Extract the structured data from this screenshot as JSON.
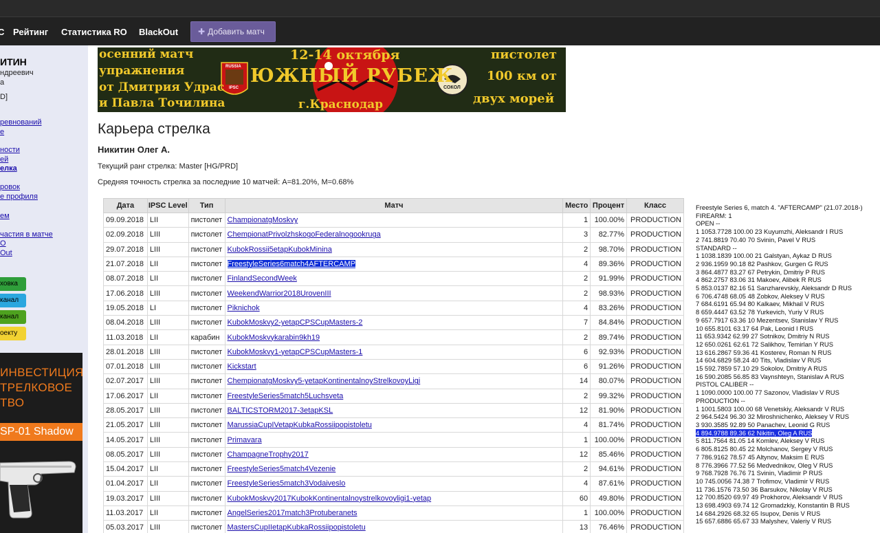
{
  "nav": {
    "cut_item": "C",
    "items": [
      "Рейтинг",
      "Статистика RO",
      "BlackOut"
    ],
    "add_match": "Добавить матч"
  },
  "sidebar": {
    "name": "ИТИН",
    "patronymic": "ндреевич",
    "line3": "а",
    "line4": "D]",
    "links": [
      "ревнований",
      "е",
      "ности",
      "ей",
      "елка",
      "ровок",
      "е профиля",
      "ем",
      "частия в матче",
      "O",
      "Out"
    ],
    "buttons": [
      {
        "label": "ховка",
        "color": "#2f9e3a"
      },
      {
        "label": "канал",
        "color": "#2aa7df"
      },
      {
        "label": "канал",
        "color": "#4ea21f"
      },
      {
        "label": "оекту",
        "color": "#f2d232"
      }
    ],
    "ad": {
      "line1": "ИНВЕСТИЦИЯ",
      "line2": "ТРЕЛКОВОЕ",
      "line3": "ТВО",
      "bar": "SP-01 Shadow"
    }
  },
  "banner": {
    "left1": "осенний матч",
    "left2": "упражнения",
    "left3": "от Дмитрия Удрас",
    "left4": "и Павла Точилина",
    "dates": "12-14 октября",
    "title": "ЮЖНЫЙ РУБЕЖ",
    "city": "г.Краснодар",
    "right1": "пистолет",
    "right2": "100 км от",
    "right3": "двух морей",
    "badge_left": "RUSSIA",
    "badge_left2": "IPSC",
    "badge_right": "СОКОЛ"
  },
  "page": {
    "title": "Карьера стрелка",
    "shooter": "Никитин Олег А.",
    "rank": "Текущий ранг стрелка: Master [HG/PRD]",
    "accuracy": "Средняя точность стрелка за последние 10 матчей: A=81.20%, M=0.68%"
  },
  "table": {
    "headers": [
      "Дата",
      "IPSC Level",
      "Тип",
      "Матч",
      "Место",
      "Процент",
      "Класс"
    ],
    "rows": [
      [
        "09.09.2018",
        "LII",
        "пистолет",
        "ChampionatgMoskvy",
        "1",
        "100.00%",
        "PRODUCTION"
      ],
      [
        "02.09.2018",
        "LIII",
        "пистолет",
        "ChempionatPrivolzhskogoFederalnogookruga",
        "3",
        "82.77%",
        "PRODUCTION"
      ],
      [
        "29.07.2018",
        "LIII",
        "пистолет",
        "KubokRossii5etapKubokMinina",
        "2",
        "98.70%",
        "PRODUCTION"
      ],
      [
        "21.07.2018",
        "LII",
        "пистолет",
        "FreestyleSeries6match4AFTERCAMP",
        "4",
        "89.36%",
        "PRODUCTION"
      ],
      [
        "08.07.2018",
        "LII",
        "пистолет",
        "FinlandSecondWeek",
        "2",
        "91.99%",
        "PRODUCTION"
      ],
      [
        "17.06.2018",
        "LIII",
        "пистолет",
        "WeekendWarrior2018UrovenIII",
        "2",
        "98.93%",
        "PRODUCTION"
      ],
      [
        "19.05.2018",
        "LI",
        "пистолет",
        "Piknichok",
        "4",
        "83.26%",
        "PRODUCTION"
      ],
      [
        "08.04.2018",
        "LIII",
        "пистолет",
        "KubokMoskvy2-yetapCPSCupMasters-2",
        "7",
        "84.84%",
        "PRODUCTION"
      ],
      [
        "11.03.2018",
        "LII",
        "карабин",
        "KubokMoskvykarabin9kh19",
        "2",
        "89.74%",
        "PRODUCTION"
      ],
      [
        "28.01.2018",
        "LIII",
        "пистолет",
        "KubokMoskvy1-yetapCPSCupMasters-1",
        "6",
        "92.93%",
        "PRODUCTION"
      ],
      [
        "07.01.2018",
        "LIII",
        "пистолет",
        "Kickstart",
        "6",
        "91.26%",
        "PRODUCTION"
      ],
      [
        "02.07.2017",
        "LIII",
        "пистолет",
        "ChempionatgMoskvy5-yetapKontinentalnoyStrelkovoyLigi",
        "14",
        "80.07%",
        "PRODUCTION"
      ],
      [
        "17.06.2017",
        "LII",
        "пистолет",
        "FreestyleSeries5match5Luchsveta",
        "2",
        "99.32%",
        "PRODUCTION"
      ],
      [
        "28.05.2017",
        "LIII",
        "пистолет",
        "BALTICSTORM2017-3etapKSL",
        "12",
        "81.90%",
        "PRODUCTION"
      ],
      [
        "21.05.2017",
        "LIII",
        "пистолет",
        "MarussiaCupIVetapKubkaRossiipopistoletu",
        "4",
        "81.74%",
        "PRODUCTION"
      ],
      [
        "14.05.2017",
        "LIII",
        "пистолет",
        "Primavara",
        "1",
        "100.00%",
        "PRODUCTION"
      ],
      [
        "08.05.2017",
        "LIII",
        "пистолет",
        "ChampagneTrophy2017",
        "12",
        "85.46%",
        "PRODUCTION"
      ],
      [
        "15.04.2017",
        "LII",
        "пистолет",
        "FreestyleSeries5match4Vezenie",
        "2",
        "94.61%",
        "PRODUCTION"
      ],
      [
        "01.04.2017",
        "LII",
        "пистолет",
        "FreestyleSeries5match3Vodaiveslo",
        "4",
        "87.61%",
        "PRODUCTION"
      ],
      [
        "19.03.2017",
        "LIII",
        "пистолет",
        "KubokMoskvy2017KubokKontinentalnoystrelkovoyligi1-yetap",
        "60",
        "49.80%",
        "PRODUCTION"
      ],
      [
        "11.03.2017",
        "LII",
        "пистолет",
        "AngelSeries2017match3Protuberanets",
        "1",
        "100.00%",
        "PRODUCTION"
      ],
      [
        "05.03.2017",
        "LIII",
        "пистолет",
        "MastersCupIIetapKubkaRossiipopistoletu",
        "13",
        "76.46%",
        "PRODUCTION"
      ]
    ],
    "selected_index": 3
  },
  "results": {
    "lines": [
      "Freestyle Series 6, match 4. \"AFTERCAMP\" (21.07.2018-)",
      "FIREARM: 1",
      "OPEN --",
      "1 1053.7728 100.00 23 Kuyumzhi, Aleksandr I RUS",
      "2 741.8819 70.40 70 Svinin, Pavel V RUS",
      "STANDARD --",
      "1 1038.1839 100.00 21 Galstyan, Aykaz D RUS",
      "2 936.1959 90.18 82 Pashkov, Gurgen G RUS",
      "3 864.4877 83.27 67 Petrykin, Dmitriy P RUS",
      "4 862.2757 83.06 31 Makoev, Alibek R RUS",
      "5 853.0137 82.16 51 Sanzharevskiy, Aleksandr D RUS",
      "6 706.4748 68.05 48 Zobkov, Aleksey V RUS",
      "7 684.6191 65.94 80 Kalkaev, Mikhail V RUS",
      "8 659.4447 63.52 78 Yurkevich, Yuriy V RUS",
      "9 657.7917 63.36 10 Mezentsev, Stanislav Y RUS",
      "10 655.8101 63.17 64 Pak, Leonid I RUS",
      "11 653.9342 62.99 27 Sotnikov, Dmitriy N RUS",
      "12 650.0261 62.61 72 Salikhov, Temirlan Y RUS",
      "13 616.2867 59.36 41 Kosterev, Roman N RUS",
      "14 604.6829 58.24 40 Tits, Vladislav V RUS",
      "15 592.7859 57.10 29 Sokolov, Dmitriy A RUS",
      "16 590.2085 56.85 83 Vaynshteyn, Stanislav A RUS",
      "PISTOL CALIBER --",
      "1 1090.0000 100.00 77 Sazonov, Vladislav V RUS",
      "PRODUCTION --",
      "1 1001.5803 100.00 68 Venetskiy, Aleksandr V RUS",
      "2 964.5424 96.30 32 Miroshnichenko, Aleksey V RUS",
      "3 930.3585 92.89 50 Panachev, Leonid G RUS",
      "4 894.9788 89.36 62 Nikitin, Oleg A RUS",
      "5 811.7564 81.05 14 Komlev, Aleksey V RUS",
      "6 805.8125 80.45 22 Molchanov, Sergey V RUS",
      "7 786.9162 78.57 45 Altynov, Maksim E RUS",
      "8 776.3966 77.52 56 Medvednikov, Oleg V RUS",
      "9 768.7928 76.76 71 Svinin, Vladimir P RUS",
      "10 745.0056 74.38 7 Trofimov, Vladimir V RUS",
      "11 736.1576 73.50 36 Barsukov, Nikolay V RUS",
      "12 700.8520 69.97 49 Prokhorov, Aleksandr V RUS",
      "13 698.4903 69.74 12 Gromadzkiy, Konstantin B RUS",
      "14 684.2926 68.32 65 Isupov, Denis V RUS",
      "15 657.6886 65.67 33 Malyshev, Valeriy V RUS"
    ],
    "highlight_index": 28
  }
}
